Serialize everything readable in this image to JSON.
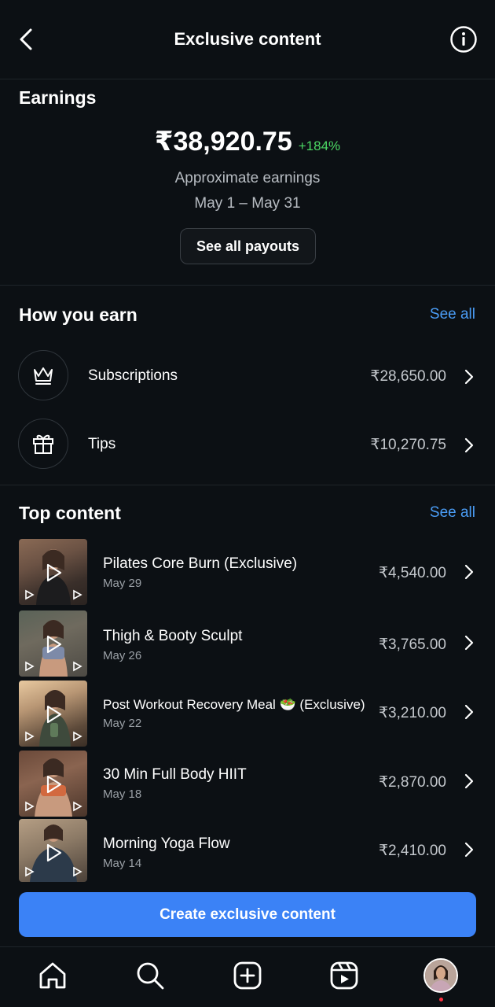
{
  "header": {
    "title": "Exclusive content"
  },
  "earnings": {
    "section_title": "Earnings",
    "amount": "₹38,920.75",
    "growth": "+184%",
    "caption": "Approximate earnings",
    "period": "May 1 – May 31",
    "payouts_label": "See all payouts"
  },
  "how_you_earn": {
    "section_title": "How you earn",
    "see_all": "See all",
    "items": [
      {
        "label": "Subscriptions",
        "value": "₹28,650.00",
        "icon": "crown-icon"
      },
      {
        "label": "Tips",
        "value": "₹10,270.75",
        "icon": "gift-icon"
      }
    ]
  },
  "top_content": {
    "section_title": "Top content",
    "see_all": "See all",
    "items": [
      {
        "title": "Pilates Core Burn (Exclusive)",
        "date": "May 29",
        "value": "₹4,540.00"
      },
      {
        "title": "Thigh & Booty Sculpt",
        "date": "May 26",
        "value": "₹3,765.00"
      },
      {
        "title": "Post Workout Recovery Meal 🥗 (Exclusive)",
        "date": "May 22",
        "value": "₹3,210.00"
      },
      {
        "title": "30 Min Full Body HIIT",
        "date": "May 18",
        "value": "₹2,870.00"
      },
      {
        "title": "Morning Yoga Flow",
        "date": "May 14",
        "value": "₹2,410.00"
      }
    ]
  },
  "cta": {
    "label": "Create exclusive content"
  },
  "tabbar": {
    "icons": [
      "home-icon",
      "search-icon",
      "create-icon",
      "reels-icon",
      "profile-avatar"
    ]
  },
  "colors": {
    "accent": "#3b82f6",
    "link": "#4a9cf5",
    "growth": "#4cd964",
    "background": "#0c1014"
  }
}
